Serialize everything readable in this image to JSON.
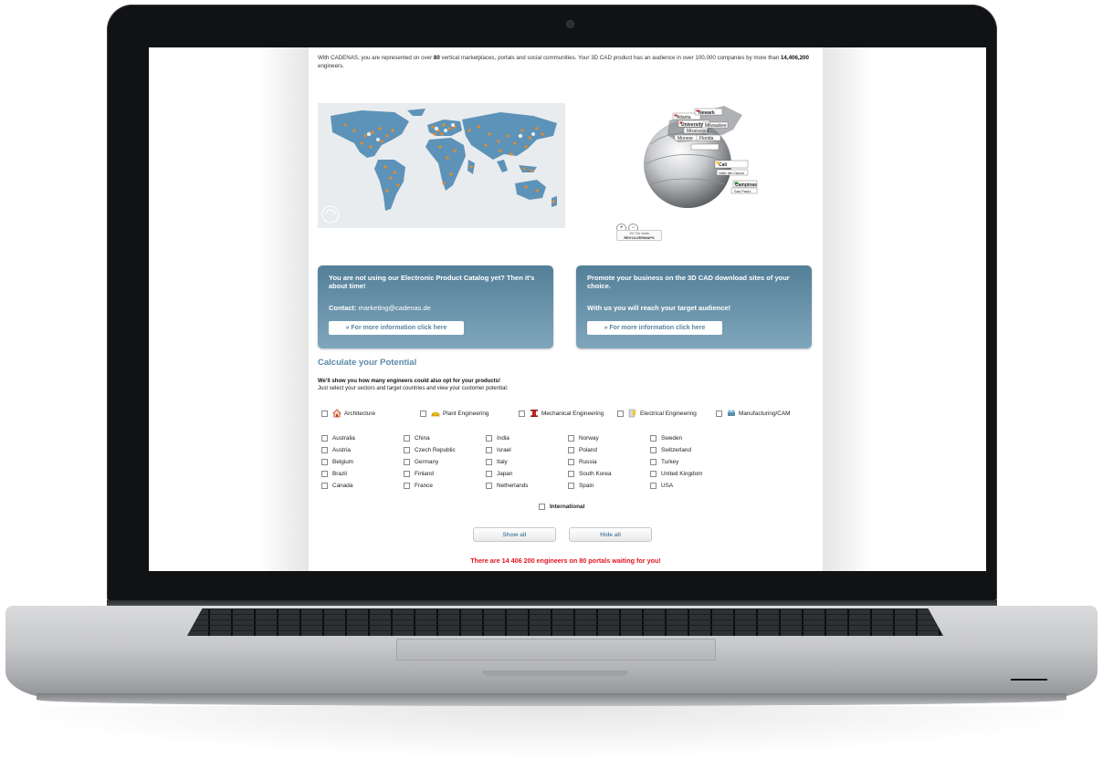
{
  "intro": {
    "part1": "With CADENAS, you are represented on over ",
    "num1": "80",
    "part2": " vertical marketplaces, portals and social communities. Your 3D CAD product has an audience in over 100,000 companies by more than ",
    "num2": "14,406,200",
    "part3": " engineers."
  },
  "globe": {
    "labels": [
      "Newark",
      "University",
      "Mississippi",
      "Atlanta",
      "Florida",
      "Milwaukee",
      "Monroe",
      "Cali",
      "Valle del Cauca",
      "Campinas",
      "Sao Paulo"
    ],
    "zoom_in": "+",
    "zoom_out": "−",
    "visits": "19.71k visits",
    "brand": "REVOLVERMAPS"
  },
  "promo_left": {
    "title": "You are not using our Electronic Product Catalog yet? Then it's about time!",
    "contact_label": "Contact:",
    "contact_value": "marketing@cadenas.de",
    "button": "» For more information click here"
  },
  "promo_right": {
    "title": "Promote your business on the 3D CAD download sites of your choice.",
    "subtitle": "With us you will reach your target audience!",
    "button": "» For more information click here"
  },
  "calculator": {
    "title": "Calculate your Potential",
    "lead": "We'll show you how many engineers could also opt for your products!",
    "lead2": "Just select your sectors and target countries and view your customer potential:",
    "sectors": [
      "Architecture",
      "Plant Engineering",
      "Mechanical Engineering",
      "Electrical Engineering",
      "Manufacturing/CAM"
    ],
    "countries": [
      [
        "Australia",
        "Austria",
        "Belgium",
        "Brazil",
        "Canada"
      ],
      [
        "China",
        "Czech Republic",
        "Germany",
        "Finland",
        "France"
      ],
      [
        "India",
        "Israel",
        "Italy",
        "Japan",
        "Netherlands"
      ],
      [
        "Norway",
        "Poland",
        "Russia",
        "South Korea",
        "Spain"
      ],
      [
        "Sweden",
        "Switzerland",
        "Turkey",
        "United Kingdom",
        "USA"
      ]
    ],
    "international": "International",
    "show_all": "Show all",
    "hide_all": "Hide all",
    "result": "There are 14 406 200 engineers on 80 portals waiting for you!"
  },
  "colors": {
    "accent": "#5a8aaa",
    "promo": "#6e97ae",
    "alert": "#e4121e",
    "map_land": "#5d93b8",
    "map_dots": "#e58a2a"
  }
}
